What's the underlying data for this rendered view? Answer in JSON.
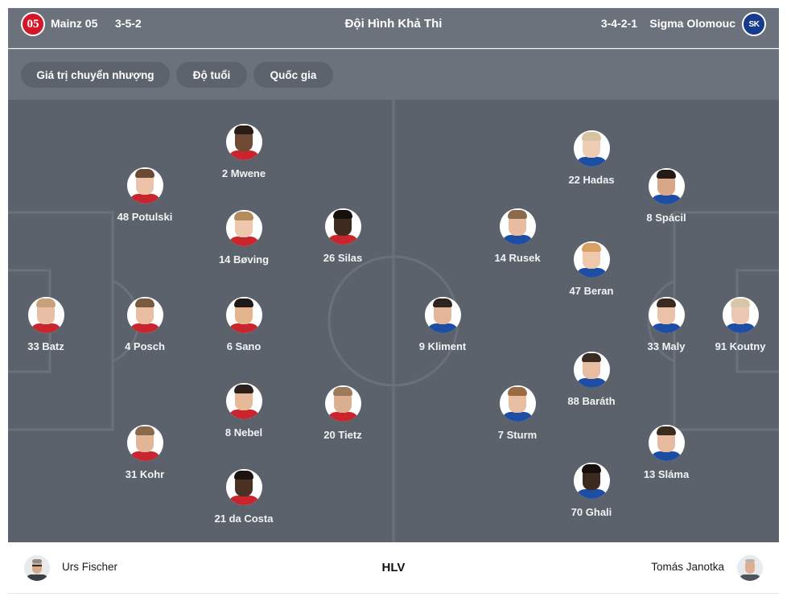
{
  "header": {
    "home_team": "Mainz 05",
    "home_formation": "3-5-2",
    "title": "Đội Hình Khả Thi",
    "away_formation": "3-4-2-1",
    "away_team": "Sigma Olomouc",
    "home_logo_text": "05",
    "away_logo_text": "SK"
  },
  "tabs": [
    {
      "label": "Giá trị chuyển nhượng"
    },
    {
      "label": "Độ tuổi"
    },
    {
      "label": "Quốc gia"
    }
  ],
  "colors": {
    "pitch": "#5b626b",
    "header": "#6b727c",
    "tab": "#5c636c",
    "home_brand": "#d3172a",
    "away_brand": "#173b8c"
  },
  "home_players": [
    {
      "label": "33 Batz",
      "skin": "#e8bfa6",
      "hair": "#c7a27a",
      "shirt": "#c9252e"
    },
    {
      "label": "48 Potulski",
      "skin": "#ecc3a8",
      "hair": "#6b4a33",
      "shirt": "#c9252e"
    },
    {
      "label": "4 Posch",
      "skin": "#e9bea2",
      "hair": "#7a5a3e",
      "shirt": "#c9252e"
    },
    {
      "label": "31 Kohr",
      "skin": "#e3b597",
      "hair": "#8a6a4c",
      "shirt": "#c9252e"
    },
    {
      "label": "2 Mwene",
      "skin": "#6e4a35",
      "hair": "#2a1d16",
      "shirt": "#c9252e"
    },
    {
      "label": "14 Bøving",
      "skin": "#eec8ac",
      "hair": "#b58a5c",
      "shirt": "#c9252e"
    },
    {
      "label": "6 Sano",
      "skin": "#e3b58f",
      "hair": "#1f1a18",
      "shirt": "#c9252e"
    },
    {
      "label": "8 Nebel",
      "skin": "#e6b999",
      "hair": "#2b211c",
      "shirt": "#c9252e"
    },
    {
      "label": "21 da Costa",
      "skin": "#4a3124",
      "hair": "#1a1310",
      "shirt": "#c9252e"
    },
    {
      "label": "26 Silas",
      "skin": "#3f2a20",
      "hair": "#15100d",
      "shirt": "#c9252e"
    },
    {
      "label": "20 Tietz",
      "skin": "#dcaf90",
      "hair": "#9b7b5c",
      "shirt": "#c9252e"
    }
  ],
  "away_players": [
    {
      "label": "91 Koutny",
      "skin": "#ecc8b2",
      "hair": "#d8c6a8",
      "shirt": "#1d4ea3"
    },
    {
      "label": "8 Spácil",
      "skin": "#d9a788",
      "hair": "#241b16",
      "shirt": "#1d4ea3"
    },
    {
      "label": "33 Maly",
      "skin": "#ebc1a7",
      "hair": "#3a2b22",
      "shirt": "#1d4ea3"
    },
    {
      "label": "13 Sláma",
      "skin": "#e6bb9f",
      "hair": "#3b2c22",
      "shirt": "#1d4ea3"
    },
    {
      "label": "22 Hadas",
      "skin": "#efcdb5",
      "hair": "#d6c3a4",
      "shirt": "#1d4ea3"
    },
    {
      "label": "47 Beran",
      "skin": "#f0c8ab",
      "hair": "#d9a064",
      "shirt": "#1d4ea3"
    },
    {
      "label": "88 Baráth",
      "skin": "#e8bda1",
      "hair": "#3a2c22",
      "shirt": "#1d4ea3"
    },
    {
      "label": "70 Ghali",
      "skin": "#3d281e",
      "hair": "#15100d",
      "shirt": "#1d4ea3"
    },
    {
      "label": "14 Rusek",
      "skin": "#e7bca0",
      "hair": "#8a6a4c",
      "shirt": "#1d4ea3"
    },
    {
      "label": "7 Sturm",
      "skin": "#e9bda2",
      "hair": "#9a6b43",
      "shirt": "#1d4ea3"
    },
    {
      "label": "9 Kliment",
      "skin": "#e4b698",
      "hair": "#2e241d",
      "shirt": "#1d4ea3"
    }
  ],
  "footer": {
    "home_coach": "Urs Fischer",
    "label": "HLV",
    "away_coach": "Tomás Janotka"
  }
}
